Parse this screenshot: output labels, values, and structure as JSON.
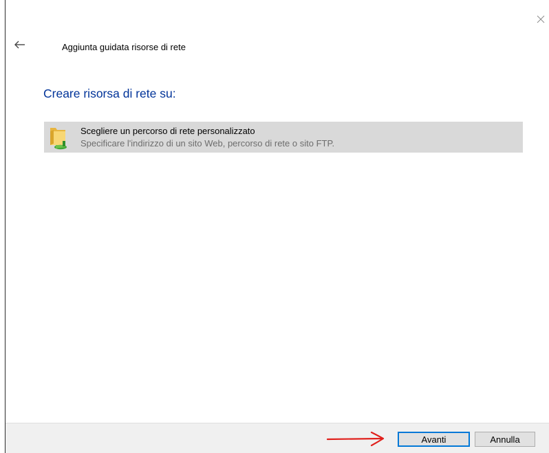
{
  "window": {
    "title": "Aggiunta guidata risorse di rete"
  },
  "nav": {
    "back_icon": "back-arrow-icon",
    "close_icon": "close-icon"
  },
  "main": {
    "heading": "Creare risorsa di rete su:",
    "options": [
      {
        "icon": "network-folder-icon",
        "title": "Scegliere un percorso di rete personalizzato",
        "description": "Specificare l'indirizzo di un sito Web, percorso di rete o sito FTP."
      }
    ]
  },
  "footer": {
    "next_label": "Avanti",
    "cancel_label": "Annulla",
    "annotation_icon": "red-arrow-annotation-icon"
  },
  "colors": {
    "heading": "#003399",
    "option_background": "#d9d9d9",
    "description_text": "#6d6d6d",
    "footer_background": "#f0f0f0",
    "default_button_border": "#0078d7",
    "annotation_arrow": "#e0201c"
  }
}
